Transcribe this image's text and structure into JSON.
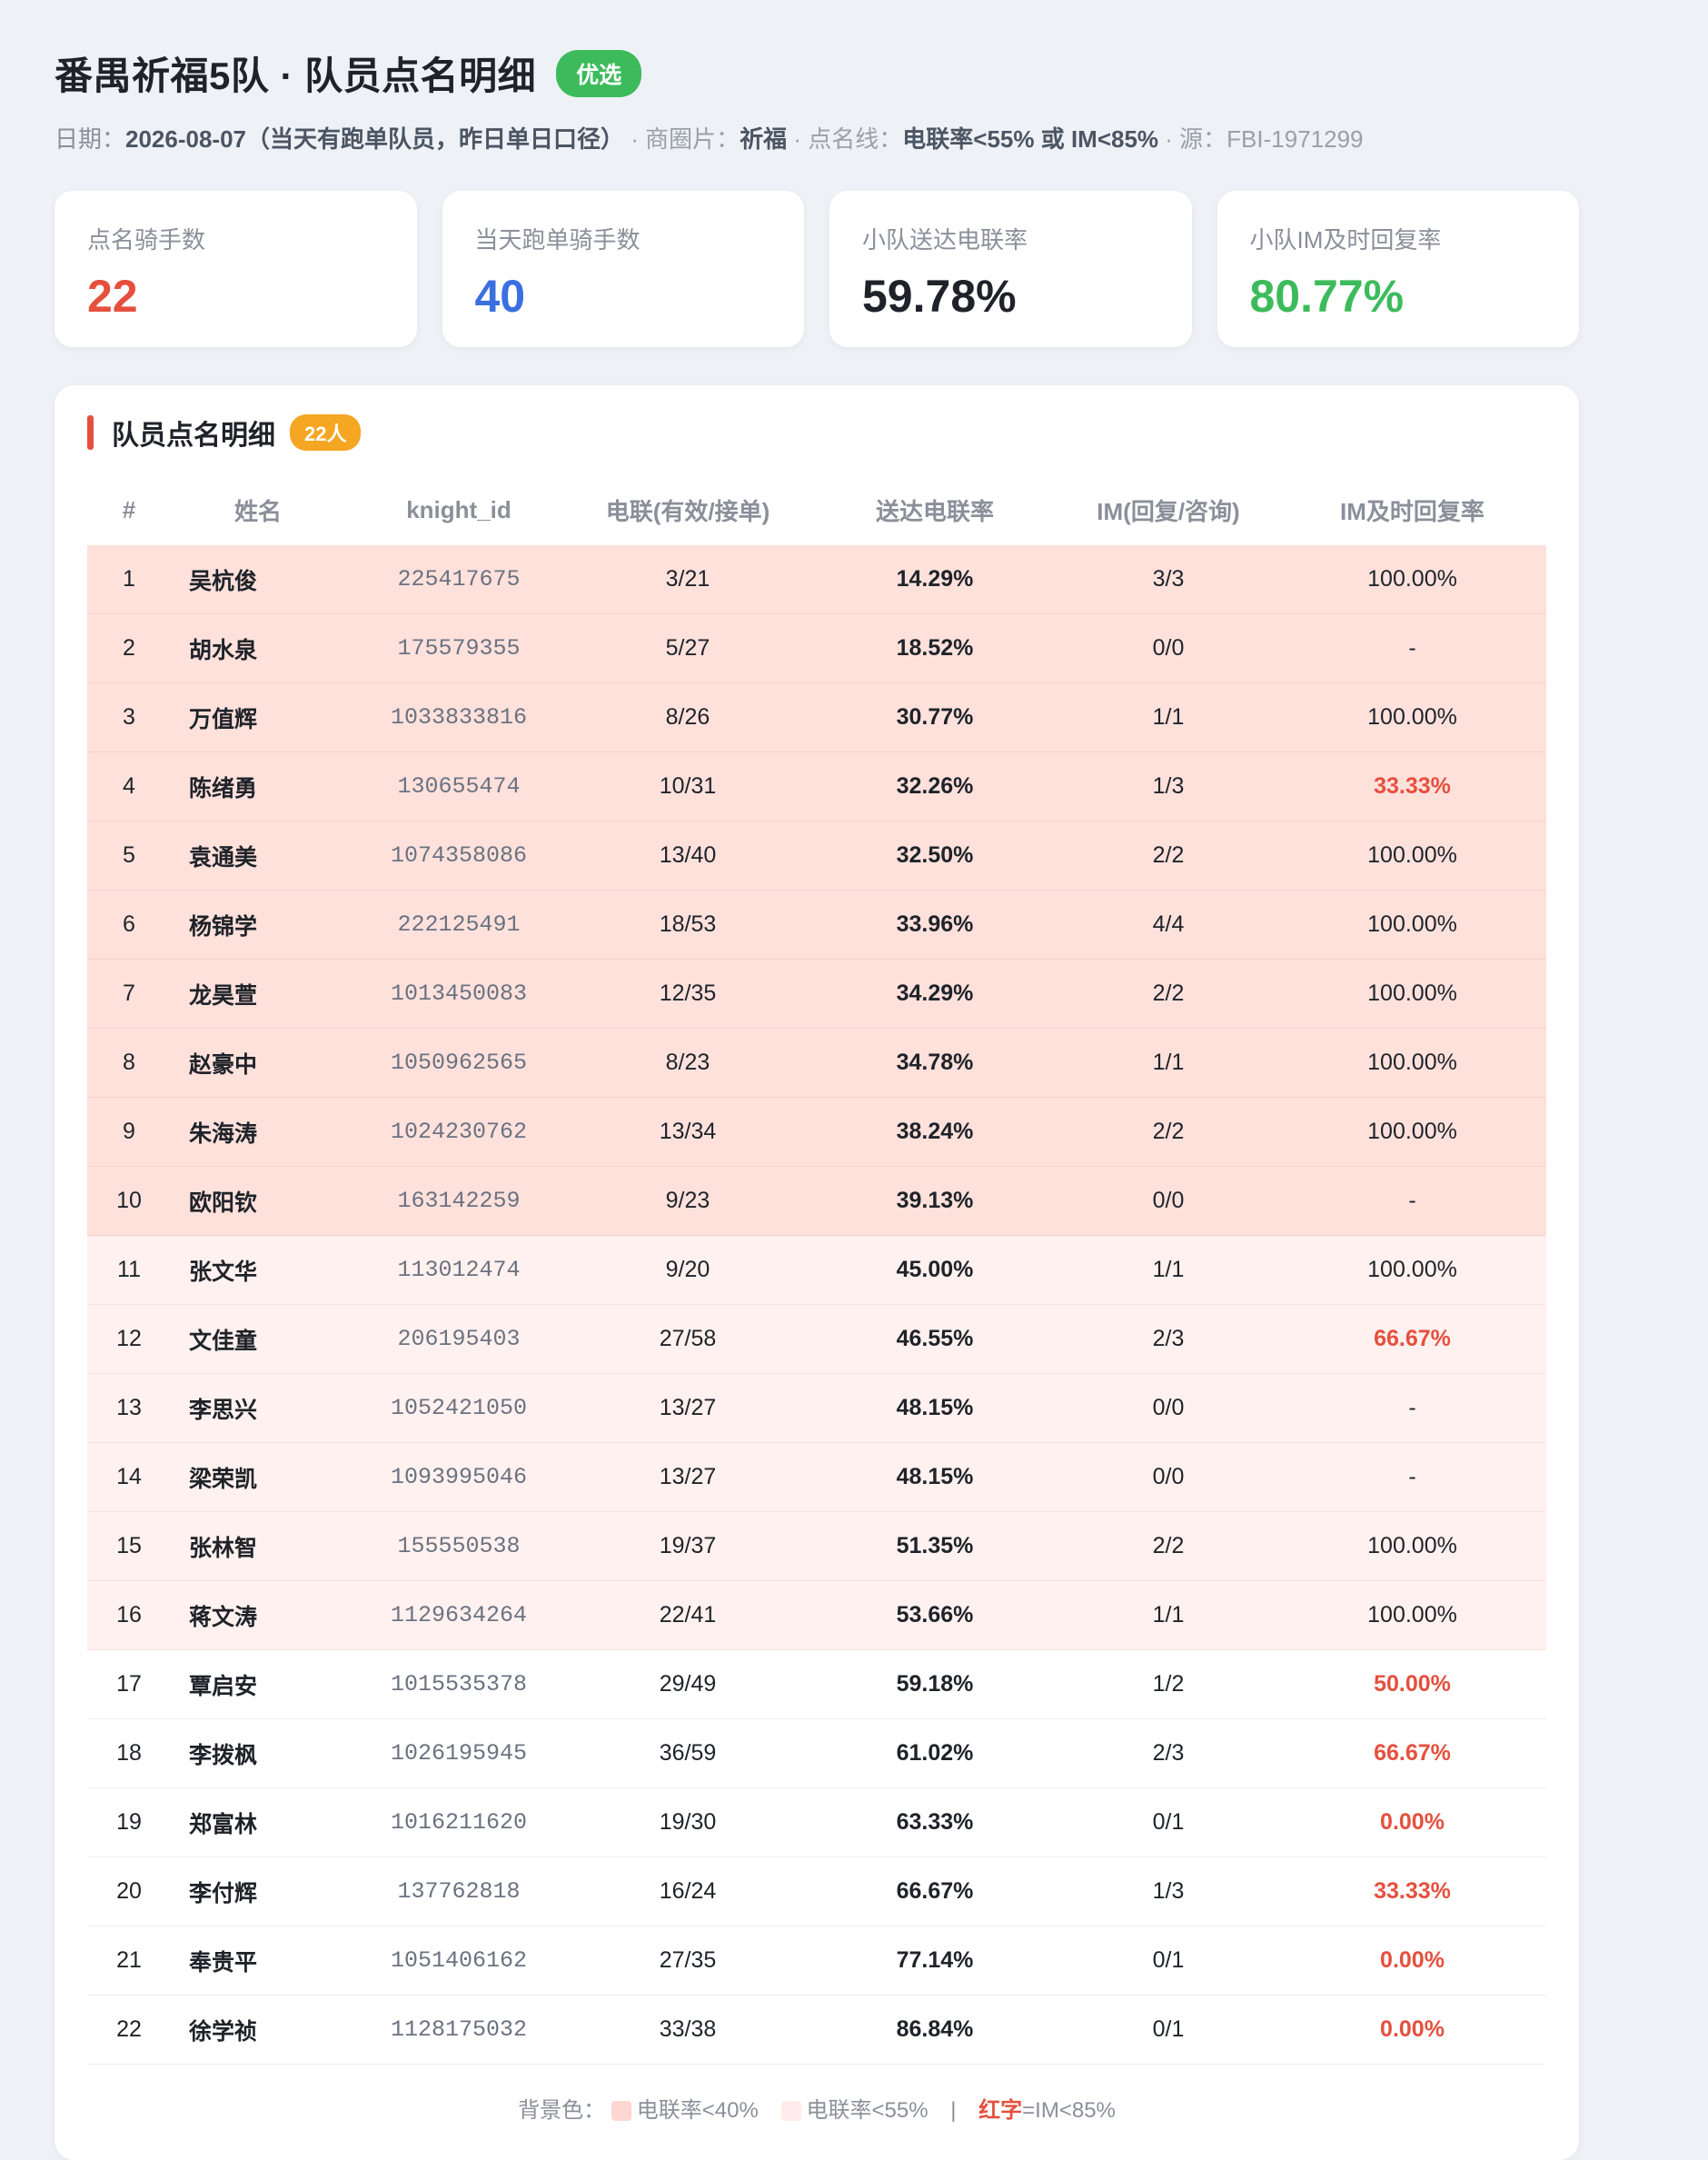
{
  "header": {
    "title": "番禺祈福5队 · 队员点名明细",
    "tag": "优选",
    "subtitle": {
      "date_label": "日期：",
      "date_value": "2026-08-07（当天有跑单队员，昨日单日口径）",
      "area_label": "· 商圈片：",
      "area_value": "祈福",
      "line_label": "· 点名线：",
      "line_value": "电联率<55% 或 IM<85%",
      "source": "· 源：FBI-1971299"
    }
  },
  "kpis": [
    {
      "label": "点名骑手数",
      "value": "22",
      "color": "#e5503e"
    },
    {
      "label": "当天跑单骑手数",
      "value": "40",
      "color": "#3b6fe0"
    },
    {
      "label": "小队送达电联率",
      "value": "59.78%",
      "color": "#1f2329"
    },
    {
      "label": "小队IM及时回复率",
      "value": "80.77%",
      "color": "#3dbb5c"
    }
  ],
  "table": {
    "title": "队员点名明细",
    "count_badge": "22人",
    "columns": [
      "#",
      "姓名",
      "knight_id",
      "电联(有效/接单)",
      "送达电联率",
      "IM(回复/咨询)",
      "IM及时回复率"
    ],
    "rows": [
      {
        "no": "1",
        "name": "吴杭俊",
        "id": "225417675",
        "call": "3/21",
        "rate": "14.29%",
        "im": "3/3",
        "imr": "100.00%",
        "bg": "deep",
        "imr_red": false
      },
      {
        "no": "2",
        "name": "胡水泉",
        "id": "175579355",
        "call": "5/27",
        "rate": "18.52%",
        "im": "0/0",
        "imr": "-",
        "bg": "deep",
        "imr_red": false
      },
      {
        "no": "3",
        "name": "万值辉",
        "id": "1033833816",
        "call": "8/26",
        "rate": "30.77%",
        "im": "1/1",
        "imr": "100.00%",
        "bg": "deep",
        "imr_red": false
      },
      {
        "no": "4",
        "name": "陈绪勇",
        "id": "130655474",
        "call": "10/31",
        "rate": "32.26%",
        "im": "1/3",
        "imr": "33.33%",
        "bg": "deep",
        "imr_red": true
      },
      {
        "no": "5",
        "name": "袁通美",
        "id": "1074358086",
        "call": "13/40",
        "rate": "32.50%",
        "im": "2/2",
        "imr": "100.00%",
        "bg": "deep",
        "imr_red": false
      },
      {
        "no": "6",
        "name": "杨锦学",
        "id": "222125491",
        "call": "18/53",
        "rate": "33.96%",
        "im": "4/4",
        "imr": "100.00%",
        "bg": "deep",
        "imr_red": false
      },
      {
        "no": "7",
        "name": "龙昊萱",
        "id": "1013450083",
        "call": "12/35",
        "rate": "34.29%",
        "im": "2/2",
        "imr": "100.00%",
        "bg": "deep",
        "imr_red": false
      },
      {
        "no": "8",
        "name": "赵豪中",
        "id": "1050962565",
        "call": "8/23",
        "rate": "34.78%",
        "im": "1/1",
        "imr": "100.00%",
        "bg": "deep",
        "imr_red": false
      },
      {
        "no": "9",
        "name": "朱海涛",
        "id": "1024230762",
        "call": "13/34",
        "rate": "38.24%",
        "im": "2/2",
        "imr": "100.00%",
        "bg": "deep",
        "imr_red": false
      },
      {
        "no": "10",
        "name": "欧阳钦",
        "id": "163142259",
        "call": "9/23",
        "rate": "39.13%",
        "im": "0/0",
        "imr": "-",
        "bg": "deep",
        "imr_red": false
      },
      {
        "no": "11",
        "name": "张文华",
        "id": "113012474",
        "call": "9/20",
        "rate": "45.00%",
        "im": "1/1",
        "imr": "100.00%",
        "bg": "light",
        "imr_red": false
      },
      {
        "no": "12",
        "name": "文佳童",
        "id": "206195403",
        "call": "27/58",
        "rate": "46.55%",
        "im": "2/3",
        "imr": "66.67%",
        "bg": "light",
        "imr_red": true
      },
      {
        "no": "13",
        "name": "李思兴",
        "id": "1052421050",
        "call": "13/27",
        "rate": "48.15%",
        "im": "0/0",
        "imr": "-",
        "bg": "light",
        "imr_red": false
      },
      {
        "no": "14",
        "name": "梁荣凯",
        "id": "1093995046",
        "call": "13/27",
        "rate": "48.15%",
        "im": "0/0",
        "imr": "-",
        "bg": "light",
        "imr_red": false
      },
      {
        "no": "15",
        "name": "张林智",
        "id": "155550538",
        "call": "19/37",
        "rate": "51.35%",
        "im": "2/2",
        "imr": "100.00%",
        "bg": "light",
        "imr_red": false
      },
      {
        "no": "16",
        "name": "蒋文涛",
        "id": "1129634264",
        "call": "22/41",
        "rate": "53.66%",
        "im": "1/1",
        "imr": "100.00%",
        "bg": "light",
        "imr_red": false
      },
      {
        "no": "17",
        "name": "覃启安",
        "id": "1015535378",
        "call": "29/49",
        "rate": "59.18%",
        "im": "1/2",
        "imr": "50.00%",
        "bg": "none",
        "imr_red": true
      },
      {
        "no": "18",
        "name": "李拨枫",
        "id": "1026195945",
        "call": "36/59",
        "rate": "61.02%",
        "im": "2/3",
        "imr": "66.67%",
        "bg": "none",
        "imr_red": true
      },
      {
        "no": "19",
        "name": "郑富林",
        "id": "1016211620",
        "call": "19/30",
        "rate": "63.33%",
        "im": "0/1",
        "imr": "0.00%",
        "bg": "none",
        "imr_red": true
      },
      {
        "no": "20",
        "name": "李付辉",
        "id": "137762818",
        "call": "16/24",
        "rate": "66.67%",
        "im": "1/3",
        "imr": "33.33%",
        "bg": "none",
        "imr_red": true
      },
      {
        "no": "21",
        "name": "奉贵平",
        "id": "1051406162",
        "call": "27/35",
        "rate": "77.14%",
        "im": "0/1",
        "imr": "0.00%",
        "bg": "none",
        "imr_red": true
      },
      {
        "no": "22",
        "name": "徐学祯",
        "id": "1128175032",
        "call": "33/38",
        "rate": "86.84%",
        "im": "0/1",
        "imr": "0.00%",
        "bg": "none",
        "imr_red": true
      }
    ]
  },
  "legend": {
    "label": "背景色：",
    "item1": "电联率<40%",
    "item1_color": "#ffd6d0",
    "item2": "电联率<55%",
    "item2_color": "#ffecea",
    "divider": "|",
    "red_text": "红字",
    "red_desc": "=IM<85%"
  }
}
